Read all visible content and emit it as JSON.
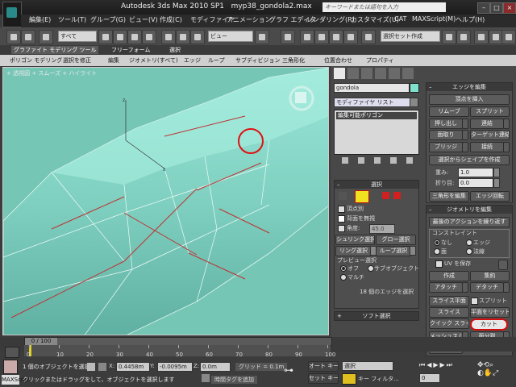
{
  "title": {
    "app": "Autodesk 3ds Max 2010 SP1",
    "file": "myp38_gondola2.max",
    "search_placeholder": "キーワードまたは語句を入力"
  },
  "menu": [
    "編集(E)",
    "ツール(T)",
    "グループ(G)",
    "ビュー(V)",
    "作成(C)",
    "モディファイヤ",
    "アニメーション",
    "グラフ エディタ",
    "レンダリング(R)",
    "カスタマイズ(U)",
    "CAT",
    "MAXScript(M)",
    "ヘルプ(H)"
  ],
  "toolbar": {
    "filter": "すべて",
    "view": "ビュー",
    "selection_set": "選択セット作成"
  },
  "ribbon": {
    "tabs": [
      "グラファイト モデリング ツール",
      "フリーフォーム",
      "選択"
    ],
    "tools": [
      "ポリゴン モデリング",
      "選択を修正",
      "編集",
      "ジオメトリ(すべて)",
      "エッジ",
      "ループ",
      "サブディビジョン",
      "三角形化",
      "位置合わせ",
      "プロパティ"
    ]
  },
  "viewport": {
    "label": "+ 透視図 + スムーズ + ハイライト"
  },
  "cmd": {
    "object_name": "gondola",
    "modifier_list": "モディファイヤ リスト",
    "stack_item": "編集可能ポリゴン",
    "selection": {
      "title": "選択",
      "by_vertex": "頂点別",
      "ignore_back": "背面を無視",
      "angle_label": "角度:",
      "angle_value": "45.0",
      "shrink": "シュリンク選択",
      "grow": "グロー選択",
      "ring": "リング選択",
      "loop": "ループ選択",
      "preview_title": "プレビュー選択",
      "off": "オフ",
      "subobj": "サブオブジェクト",
      "multi": "マルチ",
      "count": "18 個のエッジを選択"
    },
    "soft_title": "ソフト選択",
    "edit_edges": {
      "title": "エッジを編集",
      "insert_vertex": "頂点を挿入",
      "remove": "リムーブ",
      "split": "スプリット",
      "extrude": "押し出し",
      "weld": "連結",
      "chamfer": "面取り",
      "target_weld": "ターゲット連結",
      "bridge": "ブリッジ",
      "connect": "接続",
      "create_shape": "選択からシェイプを作成",
      "weight_label": "重み:",
      "weight_value": "1.0",
      "crease_label": "折り目:",
      "crease_value": "0.0",
      "edit_tri": "三角形を編集",
      "turn": "エッジ回転"
    },
    "edit_geometry": {
      "title": "ジオメトリを編集",
      "repeat_last": "最後のアクションを繰り返す",
      "constraints": "コンストレイント",
      "none": "なし",
      "edge": "エッジ",
      "face": "面",
      "normal": "法線",
      "preserve_uv": "UV を保存",
      "create": "作成",
      "collapse": "集約",
      "attach": "アタッチ",
      "detach": "デタッチ",
      "slice_plane": "スライス平面",
      "split": "スプリット",
      "slice": "スライス",
      "reset_plane": "平面をリセット",
      "quickslice": "クイック スライス",
      "cut": "カット",
      "meshsmooth": "メッシュスムーズ",
      "tessellate": "面分割",
      "planarize": "平面化"
    }
  },
  "timeline": {
    "frame": "0 / 100",
    "ticks": [
      "0",
      "10",
      "20",
      "30",
      "40",
      "50",
      "60",
      "70",
      "80",
      "90",
      "100"
    ]
  },
  "status": {
    "selected": "1 個のオブジェクトを選択",
    "prompt": "クリックまたはドラッグをして、オブジェクトを選択します",
    "x_label": "X:",
    "x_value": "0.4458m",
    "y_label": "Y:",
    "y_value": "-0.0095m",
    "z_label": "Z:",
    "z_value": "0.0m",
    "grid": "グリッド = 0.1m",
    "add_time_tag": "時間タグを追加",
    "autokey": "オート キー",
    "setkey": "セット キー",
    "key_sel": "選択",
    "key_filters": "キー フィルタ...",
    "frame_value": "0",
    "maxscript": "MAXScript"
  },
  "colors": {
    "viewport_bg": "#78c8b8",
    "selected_edge": "#c03030",
    "highlight_circle": "#e01010"
  }
}
